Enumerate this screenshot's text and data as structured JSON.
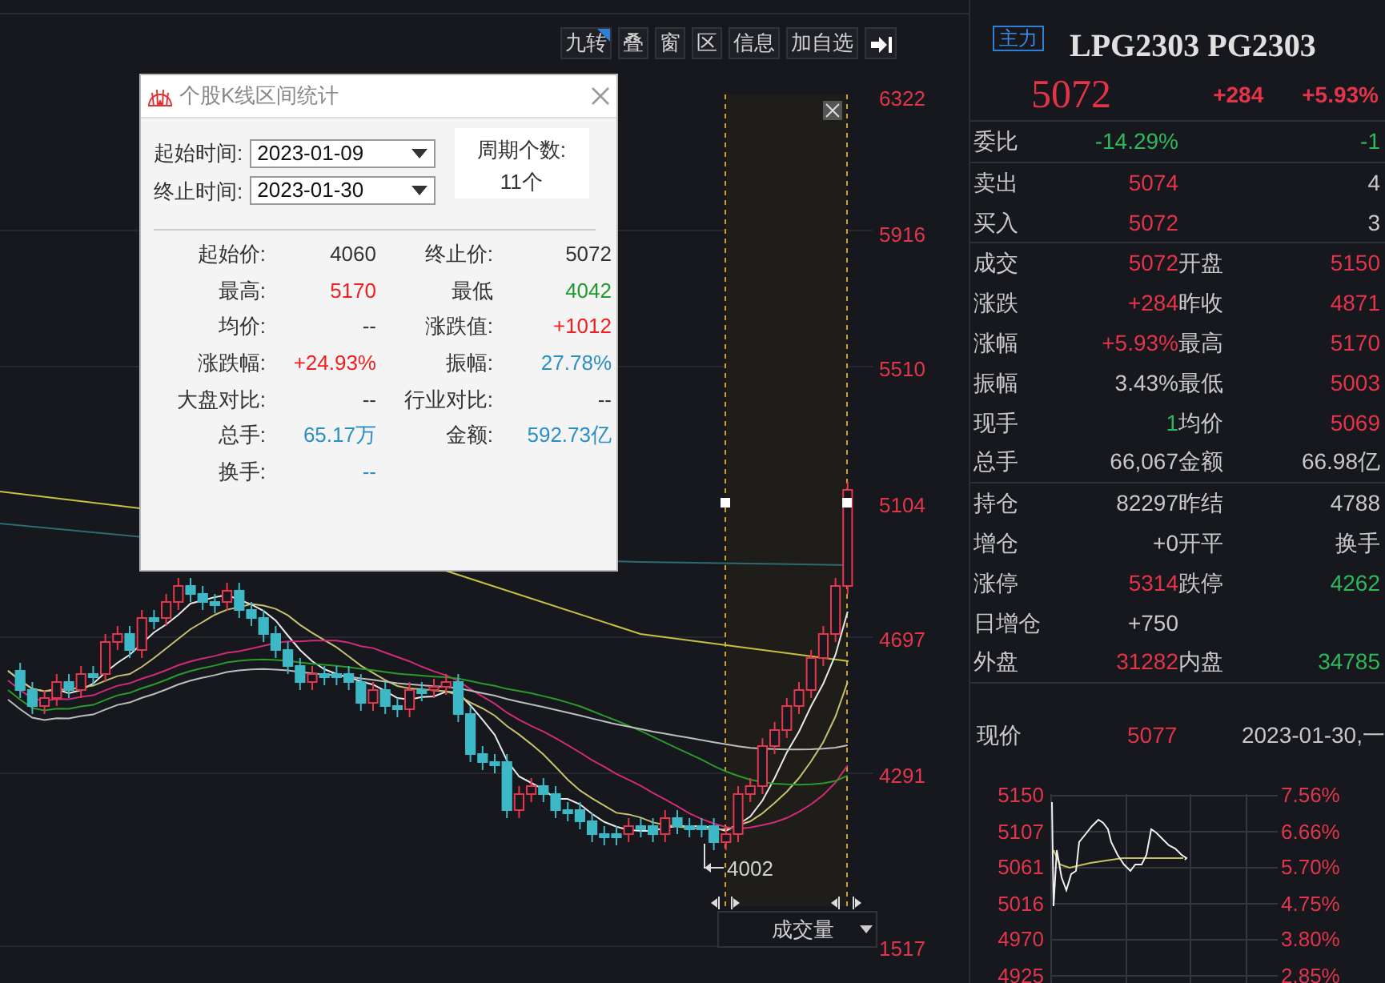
{
  "toolbar": [
    {
      "label": "九转",
      "flagged": true
    },
    {
      "label": "叠",
      "flagged": false
    },
    {
      "label": "窗",
      "flagged": false
    },
    {
      "label": "区",
      "flagged": false
    },
    {
      "label": "信息",
      "flagged": false
    },
    {
      "label": "加自选",
      "flagged": false
    }
  ],
  "chart": {
    "price_axis": [
      "6322",
      "5916",
      "5510",
      "5104",
      "4697",
      "4291"
    ],
    "volume_axis": [
      "1517"
    ],
    "low_label": "4002",
    "volume_selector": "成交量"
  },
  "dialog": {
    "title": "个股K线区间统计",
    "start_label": "起始时间:",
    "start_value": "2023-01-09",
    "end_label": "终止时间:",
    "end_value": "2023-01-30",
    "period_label": "周期个数:",
    "period_value": "11个",
    "stats": [
      {
        "label": "起始价:",
        "value": "4060",
        "color": "#333333"
      },
      {
        "label": "终止价:",
        "value": "5072",
        "color": "#333333"
      },
      {
        "label": "最高:",
        "value": "5170",
        "color": "#f02020"
      },
      {
        "label": "最低",
        "value": "4042",
        "color": "#1f9a2f"
      },
      {
        "label": "均价:",
        "value": "--",
        "color": "#333333"
      },
      {
        "label": "涨跌值:",
        "value": "+1012",
        "color": "#f02020"
      },
      {
        "label": "涨跌幅:",
        "value": "+24.93%",
        "color": "#f02020"
      },
      {
        "label": "振幅:",
        "value": "27.78%",
        "color": "#2a8fc4"
      },
      {
        "label": "大盘对比:",
        "value": "--",
        "color": "#333333"
      },
      {
        "label": "行业对比:",
        "value": "--",
        "color": "#333333"
      },
      {
        "label": "总手:",
        "value": "65.17万",
        "color": "#2a8fc4"
      },
      {
        "label": "金额:",
        "value": "592.73亿",
        "color": "#2a8fc4"
      },
      {
        "label": "换手:",
        "value": "--",
        "color": "#2a8fc4"
      }
    ]
  },
  "quote": {
    "badge": "主力",
    "title": "LPG2303 PG2303",
    "price": "5072",
    "change": "+284",
    "change_pct": "+5.93%",
    "sections": [
      [
        {
          "cells": [
            {
              "label": "委比",
              "value": "-14.29%",
              "color": "#2eb85c"
            },
            {
              "value": "-1",
              "color": "#2eb85c"
            }
          ]
        }
      ],
      [
        {
          "cells": [
            {
              "label": "卖出",
              "value": "5074",
              "color": "#e5334a"
            },
            {
              "value": "4",
              "color": "#c8c8c8"
            }
          ]
        },
        {
          "cells": [
            {
              "label": "买入",
              "value": "5072",
              "color": "#e5334a"
            },
            {
              "value": "3",
              "color": "#c8c8c8"
            }
          ]
        }
      ],
      [
        {
          "cells": [
            {
              "label": "成交",
              "value": "5072",
              "color": "#e5334a"
            },
            {
              "label": "开盘",
              "value": "5150",
              "color": "#e5334a"
            }
          ]
        },
        {
          "cells": [
            {
              "label": "涨跌",
              "value": "+284",
              "color": "#e5334a"
            },
            {
              "label": "昨收",
              "value": "4871",
              "color": "#e5334a"
            }
          ]
        },
        {
          "cells": [
            {
              "label": "涨幅",
              "value": "+5.93%",
              "color": "#e5334a"
            },
            {
              "label": "最高",
              "value": "5170",
              "color": "#e5334a"
            }
          ]
        },
        {
          "cells": [
            {
              "label": "振幅",
              "value": "3.43%",
              "color": "#c8c8c8"
            },
            {
              "label": "最低",
              "value": "5003",
              "color": "#e5334a"
            }
          ]
        },
        {
          "cells": [
            {
              "label": "现手",
              "value": "1",
              "color": "#2eb85c"
            },
            {
              "label": "均价",
              "value": "5069",
              "color": "#e5334a"
            }
          ]
        },
        {
          "cells": [
            {
              "label": "总手",
              "value": "66,067",
              "color": "#c8c8c8"
            },
            {
              "label": "金额",
              "value": "66.98亿",
              "color": "#c8c8c8"
            }
          ]
        }
      ],
      [
        {
          "cells": [
            {
              "label": "持仓",
              "value": "82297",
              "color": "#c8c8c8"
            },
            {
              "label": "昨结",
              "value": "4788",
              "color": "#c8c8c8"
            }
          ]
        },
        {
          "cells": [
            {
              "label": "增仓",
              "value": "+0",
              "color": "#c8c8c8"
            },
            {
              "label": "开平",
              "value": "换手",
              "color": "#c8c8c8"
            }
          ]
        },
        {
          "cells": [
            {
              "label": "涨停",
              "value": "5314",
              "color": "#e5334a"
            },
            {
              "label": "跌停",
              "value": "4262",
              "color": "#2eb85c"
            }
          ]
        },
        {
          "cells": [
            {
              "label": "日增仓",
              "value": "+750",
              "color": "#c8c8c8"
            }
          ]
        },
        {
          "cells": [
            {
              "label": "外盘",
              "value": "31282",
              "color": "#e5334a"
            },
            {
              "label": "内盘",
              "value": "34785",
              "color": "#2eb85c"
            }
          ]
        }
      ]
    ],
    "now_label": "现价",
    "now_value": "5077",
    "now_time": "2023-01-30,一"
  },
  "intraday": {
    "left_axis": [
      "5150",
      "5107",
      "5061",
      "5016",
      "4970",
      "4925"
    ],
    "right_axis": [
      "7.56%",
      "6.66%",
      "5.70%",
      "4.75%",
      "3.80%",
      "2.85%"
    ]
  }
}
